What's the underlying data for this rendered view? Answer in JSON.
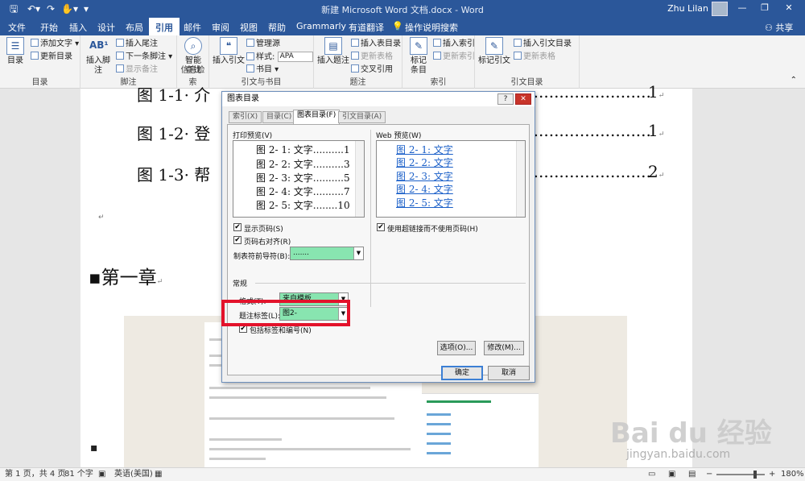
{
  "window": {
    "title": "新建 Microsoft Word 文档.docx - Word",
    "user": "Zhu Lilan",
    "share": "共享",
    "controls": {
      "minimize": "—",
      "restore": "❐",
      "close": "✕"
    }
  },
  "qat": {
    "save_icon": "save-icon",
    "undo_icon": "undo-icon",
    "redo_icon": "redo-icon",
    "touch_icon": "touch-mode-icon"
  },
  "tabs": [
    "文件",
    "开始",
    "插入",
    "设计",
    "布局",
    "引用",
    "邮件",
    "审阅",
    "视图",
    "帮助",
    "Grammarly",
    "有道翻译"
  ],
  "active_tab": "引用",
  "tell_me": "操作说明搜索",
  "ribbon": {
    "toc": {
      "label": "目录",
      "add_text": "添加文字",
      "update": "更新目录",
      "group": "目录"
    },
    "footnote": {
      "insert": "插入脚注",
      "insert_endnote": "插入尾注",
      "next": "下一条脚注",
      "show": "显示备注",
      "group": "脚注"
    },
    "research": {
      "smart_lookup": "智能\n查找",
      "group": "信息检索"
    },
    "citations": {
      "insert": "插入引文",
      "manage": "管理源",
      "style_label": "样式:",
      "style_value": "APA",
      "bibliography": "书目",
      "group": "引文与书目"
    },
    "captions": {
      "insert_caption": "插入题注",
      "insert_table": "插入表目录",
      "update_table": "更新表格",
      "cross_ref": "交叉引用",
      "group": "题注"
    },
    "index": {
      "mark_entry": "标记\n条目",
      "insert_index": "插入索引",
      "update_index": "更新索引",
      "group": "索引"
    },
    "toa": {
      "mark_citation": "标记引文",
      "insert_toa": "插入引文目录",
      "update_toa": "更新表格",
      "group": "引文目录"
    }
  },
  "document": {
    "toc_lines": [
      {
        "text": "图 1-1· 介",
        "page": "1"
      },
      {
        "text": "图 1-2· 登",
        "page": "1"
      },
      {
        "text": "图 1-3· 帮",
        "page": "2"
      }
    ],
    "chapter": "第一章"
  },
  "dialog": {
    "title": "图表目录",
    "help": "?",
    "close": "✕",
    "tabs": [
      "索引(X)",
      "目录(C)",
      "图表目录(F)",
      "引文目录(A)"
    ],
    "active_tab": "图表目录(F)",
    "print_preview_label": "打印预览(V)",
    "print_entries": [
      {
        "text": "图 2- 1:  文字..........",
        "page": "1"
      },
      {
        "text": "图 2- 2:  文字..........",
        "page": "3"
      },
      {
        "text": "图 2- 3:  文字..........",
        "page": "5"
      },
      {
        "text": "图 2- 4:  文字..........",
        "page": "7"
      },
      {
        "text": "图 2- 5:  文字........",
        "page": "10"
      }
    ],
    "web_preview_label": "Web 预览(W)",
    "web_entries": [
      "图 2- 1:  文字",
      "图 2- 2:  文字",
      "图 2- 3:  文字",
      "图 2- 4:  文字",
      "图 2- 5:  文字"
    ],
    "show_page_numbers": "显示页码(S)",
    "right_align": "页码右对齐(R)",
    "tab_leader_label": "制表符前导符(B):",
    "tab_leader_value": ".......",
    "use_hyperlinks": "使用超链接而不使用页码(H)",
    "general_label": "常规",
    "format_label": "格式(T):",
    "format_value": "来自模板",
    "caption_label_label": "题注标签(L):",
    "caption_label_value": "图2-",
    "include_label": "包括标签和编号(N)",
    "options_btn": "选项(O)...",
    "modify_btn": "修改(M)...",
    "ok_btn": "确定",
    "cancel_btn": "取消"
  },
  "statusbar": {
    "page": "第 1 页，共 4 页",
    "words": "81 个字",
    "language": "英语(美国)",
    "zoom": "180%"
  },
  "watermark": {
    "brand": "Bai du 经验",
    "url": "jingyan.baidu.com"
  },
  "colors": {
    "word_blue": "#2b579a",
    "highlight_green": "#88e5b0",
    "annotation_red": "#e3122b",
    "link_blue": "#1a5fc8"
  }
}
